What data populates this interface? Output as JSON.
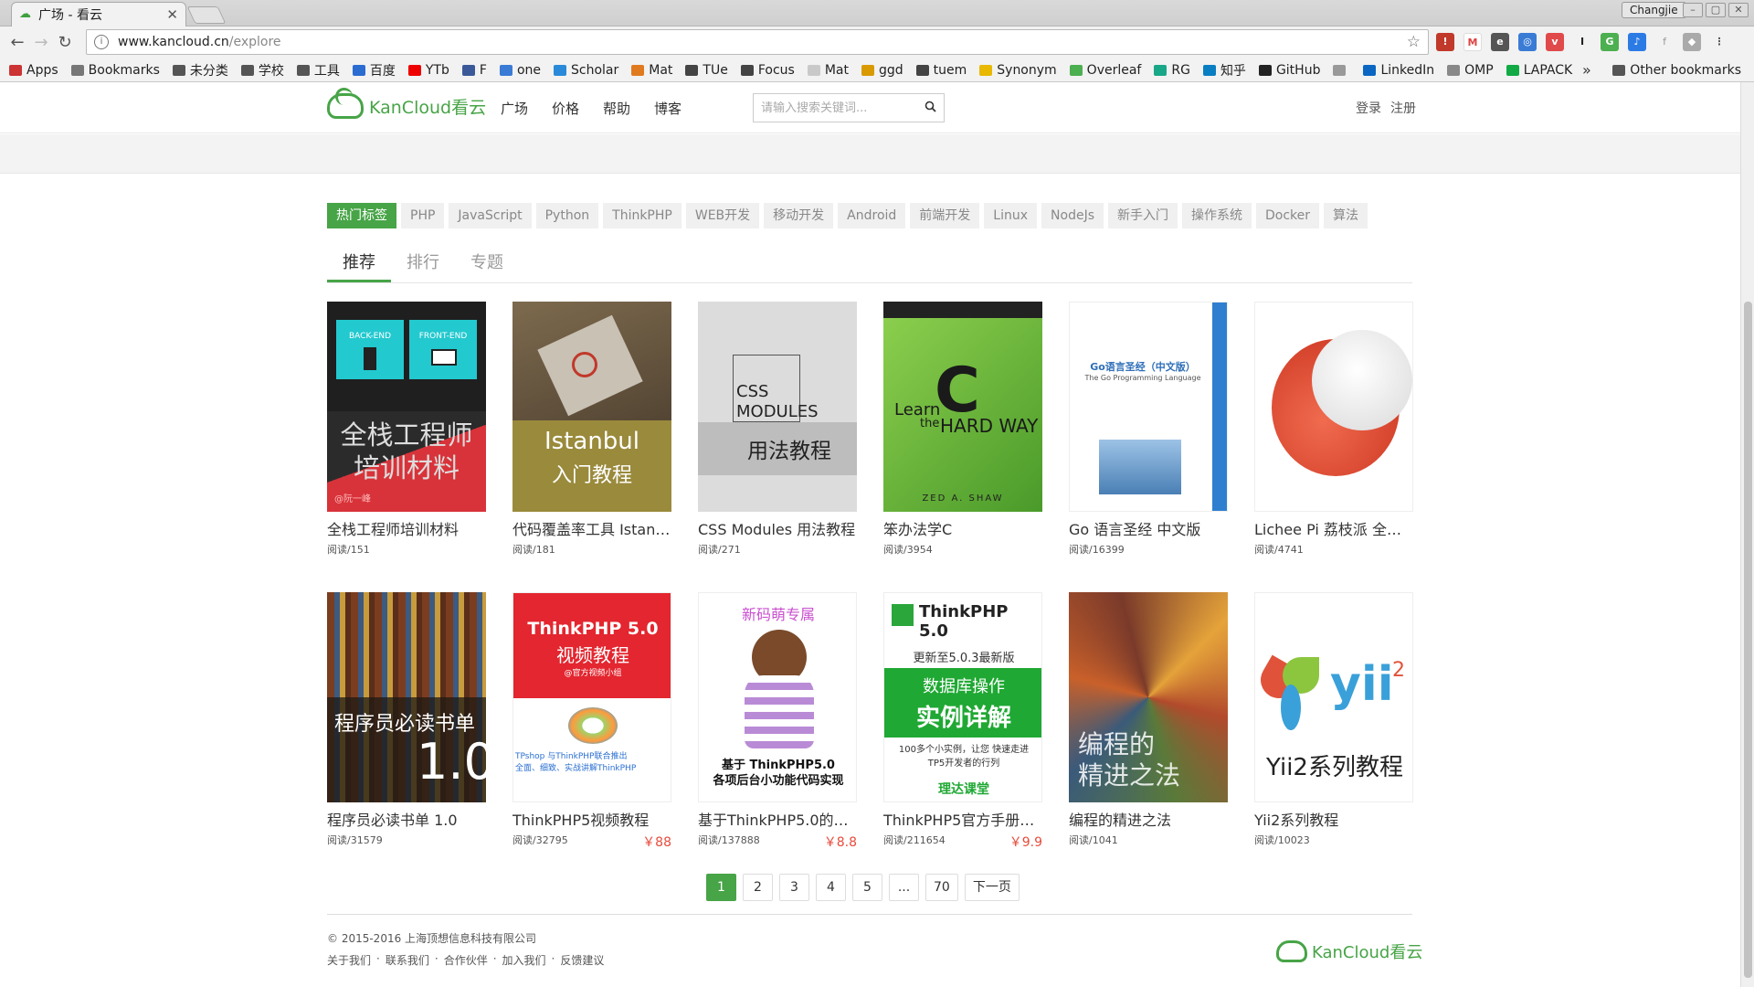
{
  "browser": {
    "tab_title": "广场 - 看云",
    "profile": "Changjie",
    "url_host": "www.kancloud.cn",
    "url_path": "/explore",
    "bookmarks": [
      "Apps",
      "Bookmarks",
      "未分类",
      "学校",
      "工具",
      "百度",
      "YTb",
      "F",
      "one",
      "Scholar",
      "Mat",
      "TUe",
      "Focus",
      "Mat",
      "ggd",
      "tuem",
      "Synonym",
      "Overleaf",
      "RG",
      "知乎",
      "GitHub",
      "",
      "LinkedIn",
      "OMP",
      "LAPACK"
    ],
    "other_bookmarks": "Other bookmarks"
  },
  "header": {
    "logo_text": "KanCloud看云",
    "nav": [
      "广场",
      "价格",
      "帮助",
      "博客"
    ],
    "search_placeholder": "请输入搜索关键词...",
    "login": "登录",
    "register": "注册"
  },
  "tags": [
    "热门标签",
    "PHP",
    "JavaScript",
    "Python",
    "ThinkPHP",
    "WEB开发",
    "移动开发",
    "Android",
    "前端开发",
    "Linux",
    "NodeJs",
    "新手入门",
    "操作系统",
    "Docker",
    "算法"
  ],
  "subtabs": [
    "推荐",
    "排行",
    "专题"
  ],
  "books": [
    {
      "title": "全栈工程师培训材料",
      "reads": "阅读/151",
      "price": "",
      "cover_text": [
        "全栈工程师",
        "培训材料"
      ],
      "cover_sub": [
        "BACK-END",
        "FRONT-END"
      ],
      "author": "@阮一峰"
    },
    {
      "title": "代码覆盖率工具 Istan…",
      "reads": "阅读/181",
      "price": "",
      "cover_text": [
        "Istanbul",
        "入门教程"
      ]
    },
    {
      "title": "CSS Modules 用法教程",
      "reads": "阅读/271",
      "price": "",
      "cover_text": [
        "CSS",
        "MODULES",
        "用法教程"
      ]
    },
    {
      "title": "笨办法学C",
      "reads": "阅读/3954",
      "price": "",
      "cover_text": [
        "Learn",
        "the",
        "C",
        "HARD WAY",
        "ZED A. SHAW"
      ]
    },
    {
      "title": "Go 语言圣经 中文版",
      "reads": "阅读/16399",
      "price": "",
      "cover_text": [
        "Go语言圣经（中文版）",
        "The Go Programming Language"
      ]
    },
    {
      "title": "Lichee Pi 荔枝派 全流…",
      "reads": "阅读/4741",
      "price": ""
    },
    {
      "title": "程序员必读书单 1.0",
      "reads": "阅读/31579",
      "price": "",
      "cover_text": [
        "程序员必读书单",
        "1.0"
      ]
    },
    {
      "title": "ThinkPHP5视频教程",
      "reads": "阅读/32795",
      "price": "￥88",
      "cover_text": [
        "ThinkPHP 5.0",
        "视频教程",
        "@官方视频小组",
        "TPshop 与ThinkPHP联合推出",
        "全面、细致、实战讲解ThinkPHP"
      ]
    },
    {
      "title": "基于ThinkPHP5.0的…",
      "reads": "阅读/137888",
      "price": "￥8.8",
      "cover_text": [
        "新码萌专属",
        "基于 ThinkPHP5.0",
        "各项后台小功能代码实现"
      ]
    },
    {
      "title": "ThinkPHP5官方手册…",
      "reads": "阅读/211654",
      "price": "￥9.9",
      "cover_text": [
        "ThinkPHP 5.0",
        "更新至5.0.3最新版",
        "数据库操作",
        "实例详解",
        "100多个小实例，让您 快速走进TP5开发者的行列",
        "理达课堂"
      ]
    },
    {
      "title": "编程的精进之法",
      "reads": "阅读/1041",
      "price": "",
      "cover_text": [
        "编程的",
        "精进之法"
      ]
    },
    {
      "title": "Yii2系列教程",
      "reads": "阅读/10023",
      "price": "",
      "cover_text": [
        "yii",
        "2",
        "Yii2系列教程"
      ]
    }
  ],
  "pager": [
    "1",
    "2",
    "3",
    "4",
    "5",
    "...",
    "70",
    "下一页"
  ],
  "footer": {
    "copyright": "© 2015-2016 上海顶想信息科技有限公司",
    "links": [
      "关于我们",
      "·",
      "联系我们",
      "·",
      "合作伙伴",
      "·",
      "加入我们",
      "·",
      "反馈建议"
    ],
    "logo_text": "KanCloud看云"
  },
  "colors": {
    "accent": "#47a447",
    "price": "#e74c3c"
  }
}
